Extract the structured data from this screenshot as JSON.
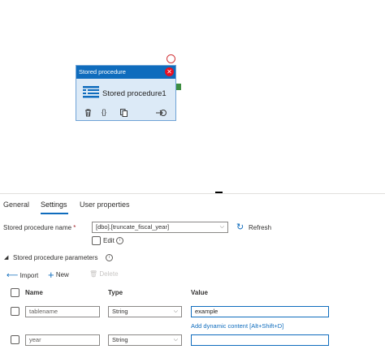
{
  "activity": {
    "type_label": "Stored procedure",
    "name": "Stored procedure1",
    "close_glyph": "✕",
    "accent_color": "#0f6cbd",
    "error_color": "#d13438",
    "icons": [
      "stored-procedure-icon",
      "delete-icon",
      "code-icon",
      "copy-icon",
      "add-output-icon"
    ]
  },
  "tabs": [
    {
      "label": "General",
      "active": false
    },
    {
      "label": "Settings",
      "active": true
    },
    {
      "label": "User properties",
      "active": false
    }
  ],
  "settings": {
    "proc_name_label": "Stored procedure name",
    "required_mark": "*",
    "proc_name_value": "[dbo].[truncate_fiscal_year]",
    "refresh_label": "Refresh",
    "edit_label": "Edit",
    "params_section_label": "Stored procedure parameters",
    "import_label": "Import",
    "new_label": "New",
    "delete_label": "Delete",
    "columns": {
      "name": "Name",
      "type": "Type",
      "value": "Value"
    },
    "dynamic_content_link": "Add dynamic content [Alt+Shift+D]",
    "params": [
      {
        "name": "tablename",
        "type": "String",
        "value": "example"
      },
      {
        "name": "year",
        "type": "String",
        "value": ""
      }
    ]
  }
}
